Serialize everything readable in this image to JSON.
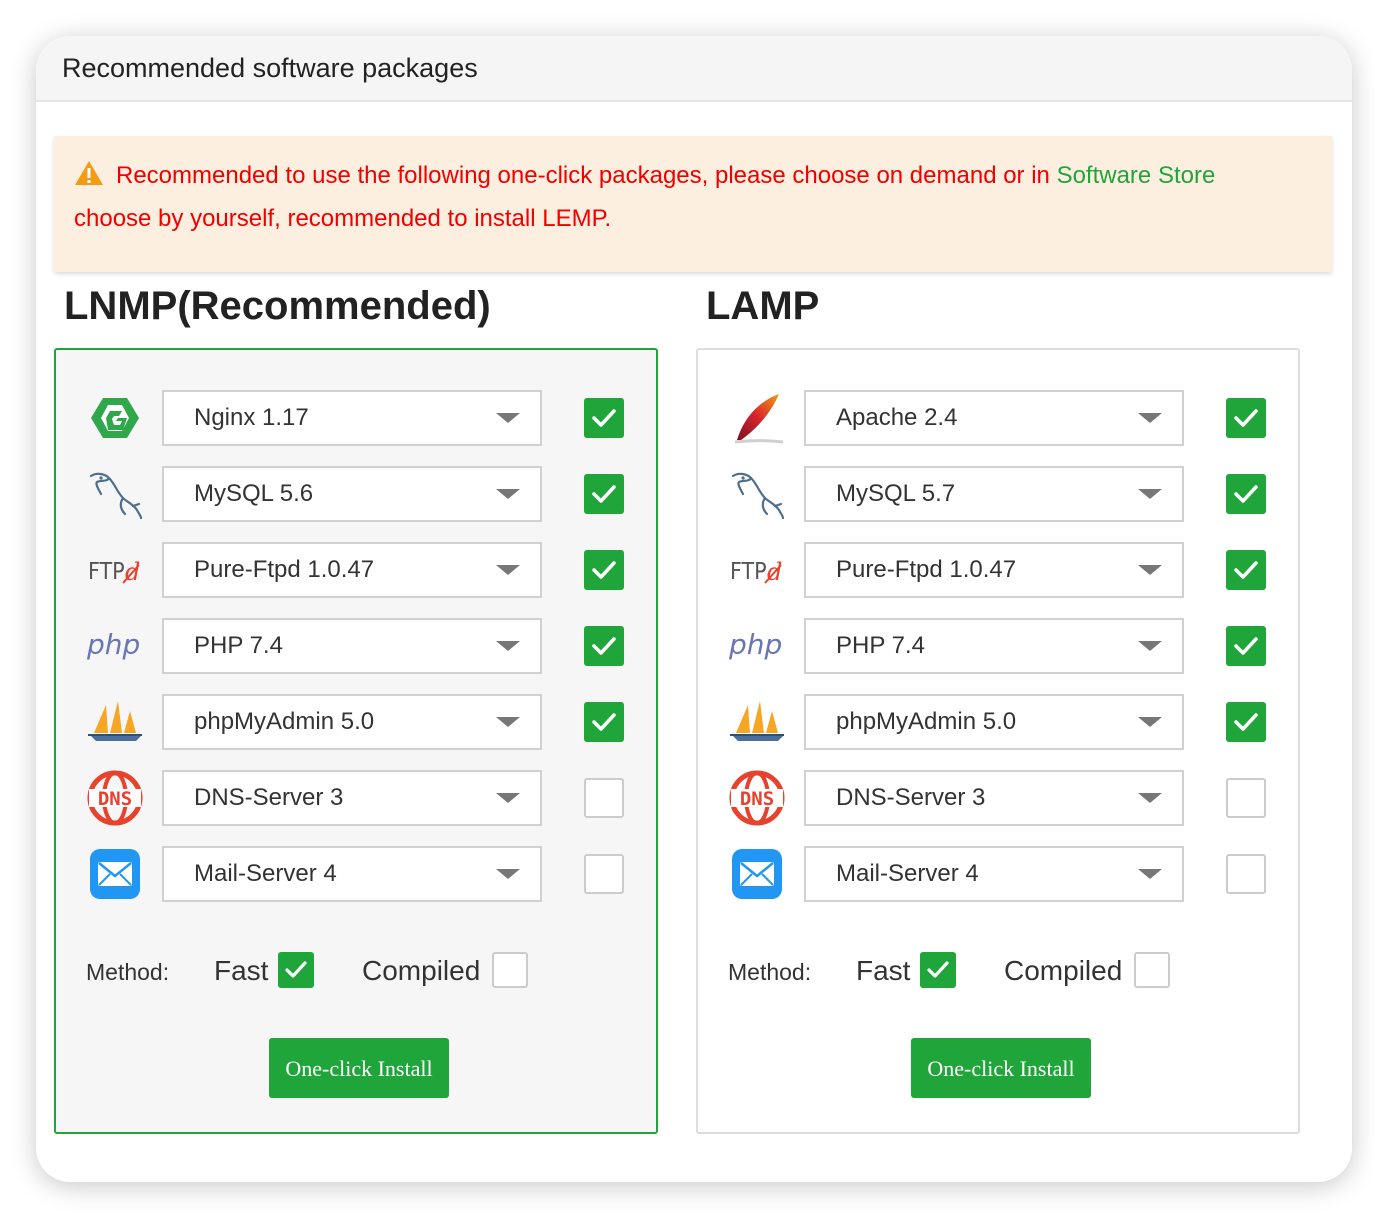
{
  "dialog": {
    "title": "Recommended software packages",
    "notice": {
      "text_before": "Recommended to use the following one-click packages, please choose on demand or in",
      "link": "Software Store",
      "text_after": "choose by yourself, recommended to install LEMP."
    }
  },
  "colors": {
    "accent_green": "#20a53a",
    "warning_red": "#f00000",
    "notice_bg": "#fcefe0"
  },
  "lnmp": {
    "title": "LNMP(Recommended)",
    "packages": [
      {
        "icon": "nginx-icon",
        "version": "Nginx 1.17",
        "checked": true
      },
      {
        "icon": "mysql-icon",
        "version": "MySQL 5.6",
        "checked": true
      },
      {
        "icon": "ftp-icon",
        "version": "Pure-Ftpd 1.0.47",
        "checked": true
      },
      {
        "icon": "php-icon",
        "version": "PHP 7.4",
        "checked": true
      },
      {
        "icon": "phpmyadmin-icon",
        "version": "phpMyAdmin 5.0",
        "checked": true
      },
      {
        "icon": "dns-icon",
        "version": "DNS-Server 3",
        "checked": false
      },
      {
        "icon": "mail-icon",
        "version": "Mail-Server 4",
        "checked": false
      }
    ],
    "method_label": "Method:",
    "fast_label": "Fast",
    "fast_checked": true,
    "compiled_label": "Compiled",
    "compiled_checked": false,
    "install_label": "One-click Install"
  },
  "lamp": {
    "title": "LAMP",
    "packages": [
      {
        "icon": "apache-icon",
        "version": "Apache 2.4",
        "checked": true
      },
      {
        "icon": "mysql-icon",
        "version": "MySQL 5.7",
        "checked": true
      },
      {
        "icon": "ftp-icon",
        "version": "Pure-Ftpd 1.0.47",
        "checked": true
      },
      {
        "icon": "php-icon",
        "version": "PHP 7.4",
        "checked": true
      },
      {
        "icon": "phpmyadmin-icon",
        "version": "phpMyAdmin 5.0",
        "checked": true
      },
      {
        "icon": "dns-icon",
        "version": "DNS-Server 3",
        "checked": false
      },
      {
        "icon": "mail-icon",
        "version": "Mail-Server 4",
        "checked": false
      }
    ],
    "method_label": "Method:",
    "fast_label": "Fast",
    "fast_checked": true,
    "compiled_label": "Compiled",
    "compiled_checked": false,
    "install_label": "One-click Install"
  }
}
